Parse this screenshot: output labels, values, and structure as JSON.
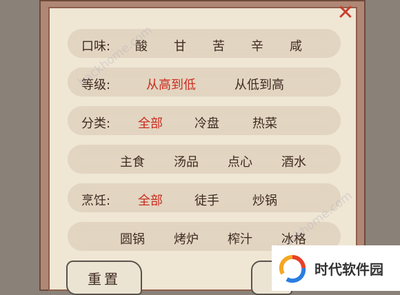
{
  "filters": {
    "taste": {
      "label": "口味:",
      "options": [
        "酸",
        "甘",
        "苦",
        "辛",
        "咸"
      ]
    },
    "level": {
      "label": "等级:",
      "options": [
        "从高到低",
        "从低到高"
      ],
      "selected": "从高到低"
    },
    "category": {
      "label": "分类:",
      "row1": [
        "全部",
        "冷盘",
        "热菜"
      ],
      "row2": [
        "主食",
        "汤品",
        "点心",
        "酒水"
      ],
      "selected": "全部"
    },
    "cooking": {
      "label": "烹饪:",
      "row1": [
        "全部",
        "徒手",
        "炒锅"
      ],
      "row2": [
        "圆锅",
        "烤炉",
        "榨汁",
        "冰格"
      ],
      "selected": "全部"
    }
  },
  "buttons": {
    "reset_label": "重置",
    "close_icon": "close-icon"
  },
  "watermark": {
    "brand": "时代软件园",
    "faint": "hackhome.com"
  },
  "colors": {
    "selected": "#cc2b20",
    "text": "#3f2b22",
    "panel": "#efe6d4",
    "frame": "#b08774"
  }
}
